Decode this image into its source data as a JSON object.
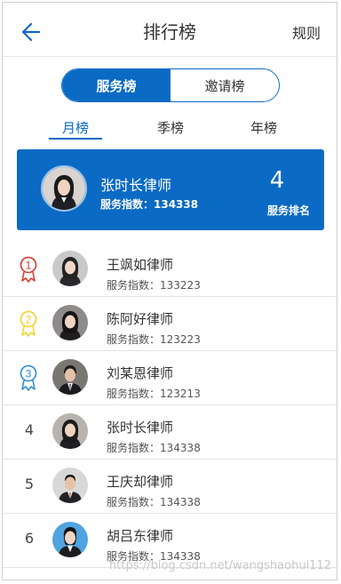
{
  "header": {
    "title": "排行榜",
    "rules": "规则"
  },
  "toggle": {
    "active": "服务榜",
    "inactive": "邀请榜"
  },
  "periods": [
    "月榜",
    "季榜",
    "年榜"
  ],
  "me": {
    "name": "张时长律师",
    "score_text": "服务指数：134338",
    "rank": "4",
    "rank_label": "服务排名"
  },
  "rows": [
    {
      "rank": "1",
      "name": "王飒如律师",
      "score_label": "服务指数：",
      "score": "133223"
    },
    {
      "rank": "2",
      "name": "陈阿好律师",
      "score_label": "服务指数：",
      "score": "123223"
    },
    {
      "rank": "3",
      "name": "刘某恩律师",
      "score_label": "服务指数：",
      "score": "123213"
    },
    {
      "rank": "4",
      "name": "张时长律师",
      "score_label": "服务指数：",
      "score": "134338"
    },
    {
      "rank": "5",
      "name": "王庆却律师",
      "score_label": "服务指数：",
      "score": "134338"
    },
    {
      "rank": "6",
      "name": "胡吕东律师",
      "score_label": "服务指数：",
      "score": "134338"
    }
  ],
  "watermark": "https://blog.csdn.net/wangshaohui112",
  "colors": {
    "accent": "#0a6ac4",
    "gold": "#f3d128",
    "red": "#d9362b",
    "blue_medal": "#2b8bd6"
  }
}
